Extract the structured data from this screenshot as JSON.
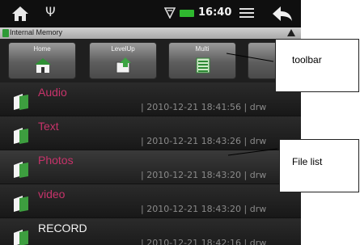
{
  "status_bar": {
    "usb_symbol": "Ψ",
    "time": "16:40",
    "battery_color": "#2fb82f"
  },
  "path_bar": {
    "location": "Internal Memory"
  },
  "toolbar": {
    "buttons": [
      {
        "label": "Home",
        "icon": "home-icon"
      },
      {
        "label": "LevelUp",
        "icon": "levelup-icon"
      },
      {
        "label": "Multi",
        "icon": "multi-select-icon"
      },
      {
        "label": "Edi",
        "icon": "edit-icon"
      }
    ]
  },
  "files": [
    {
      "name": "Audio",
      "date": "2010-12-21 18:41:56",
      "owner": "drw"
    },
    {
      "name": "Text",
      "date": "2010-12-21 18:43:26",
      "owner": "drw"
    },
    {
      "name": "Photos",
      "date": "2010-12-21 18:43:20",
      "owner": "drw"
    },
    {
      "name": "video",
      "date": "2010-12-21 18:43:20",
      "owner": "drw"
    },
    {
      "name": "RECORD",
      "date": "2010-12-21 18:42:16",
      "owner": "drw"
    }
  ],
  "annotations": {
    "toolbar_label": "toolbar",
    "filelist_label": "File list"
  },
  "colors": {
    "folder_green": "#3d9e3f",
    "name_pink": "#c7336a"
  }
}
